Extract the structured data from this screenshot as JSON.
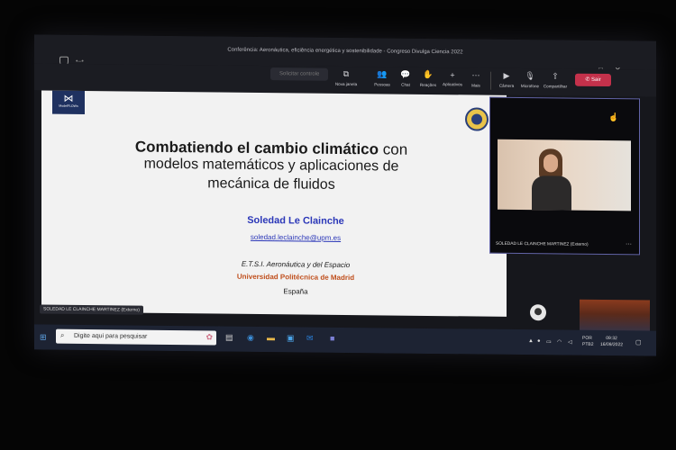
{
  "window": {
    "title": "Conferência: Aeronáutica, eficiência energética y sostenibilidade - Congreso Divulga Ciencia 2022",
    "controls": [
      "—",
      "□",
      "✕"
    ]
  },
  "toolbar": {
    "take_control": "Solicitar controle",
    "buttons": [
      {
        "label": "Nova janela",
        "icon": "pop-out-icon",
        "glyph": "⧉"
      },
      {
        "label": "Pessoas",
        "icon": "people-icon",
        "glyph": "👥"
      },
      {
        "label": "Chat",
        "icon": "chat-icon",
        "glyph": "💬"
      },
      {
        "label": "Reações",
        "icon": "reactions-icon",
        "glyph": "✋"
      },
      {
        "label": "Aplicativos",
        "icon": "apps-icon",
        "glyph": "+"
      },
      {
        "label": "Mais",
        "icon": "more-icon",
        "glyph": "⋯"
      },
      {
        "label": "Câmera",
        "icon": "camera-icon",
        "glyph": "▶"
      },
      {
        "label": "Microfone",
        "icon": "microphone-icon",
        "glyph": "🎙"
      },
      {
        "label": "Compartilhar",
        "icon": "share-icon",
        "glyph": "⇪"
      }
    ],
    "leave_label": "Sair"
  },
  "slide": {
    "title_bold": "Combatiendo el cambio climático",
    "title_rest": " con",
    "line2": "modelos matemáticos y aplicaciones de",
    "line3": "mecánica de fluidos",
    "author": "Soledad Le Clainche",
    "email": "soledad.leclainche@upm.es",
    "school": "E.T.S.I. Aeronáutica y del Espacio",
    "university": "Universidad Politécnica de Madrid",
    "country": "España",
    "logo_text": "ModelFLOWs"
  },
  "stage": {
    "presenter_label": "SOLEDAD LE CLAINCHE MARTINEZ (Externo)",
    "video_name": "SOLEDAD LE CLAINCHE MARTINEZ (Externo)",
    "more": "⋯"
  },
  "taskbar": {
    "search_placeholder": "Digite aqui para pesquisar",
    "language": "POR",
    "layout": "PTB2",
    "time": "09:32",
    "date": "16/09/2022"
  },
  "colors": {
    "accent": "#6264a7",
    "leave": "#c4314b",
    "author": "#2b37b8",
    "university": "#c0501e"
  }
}
